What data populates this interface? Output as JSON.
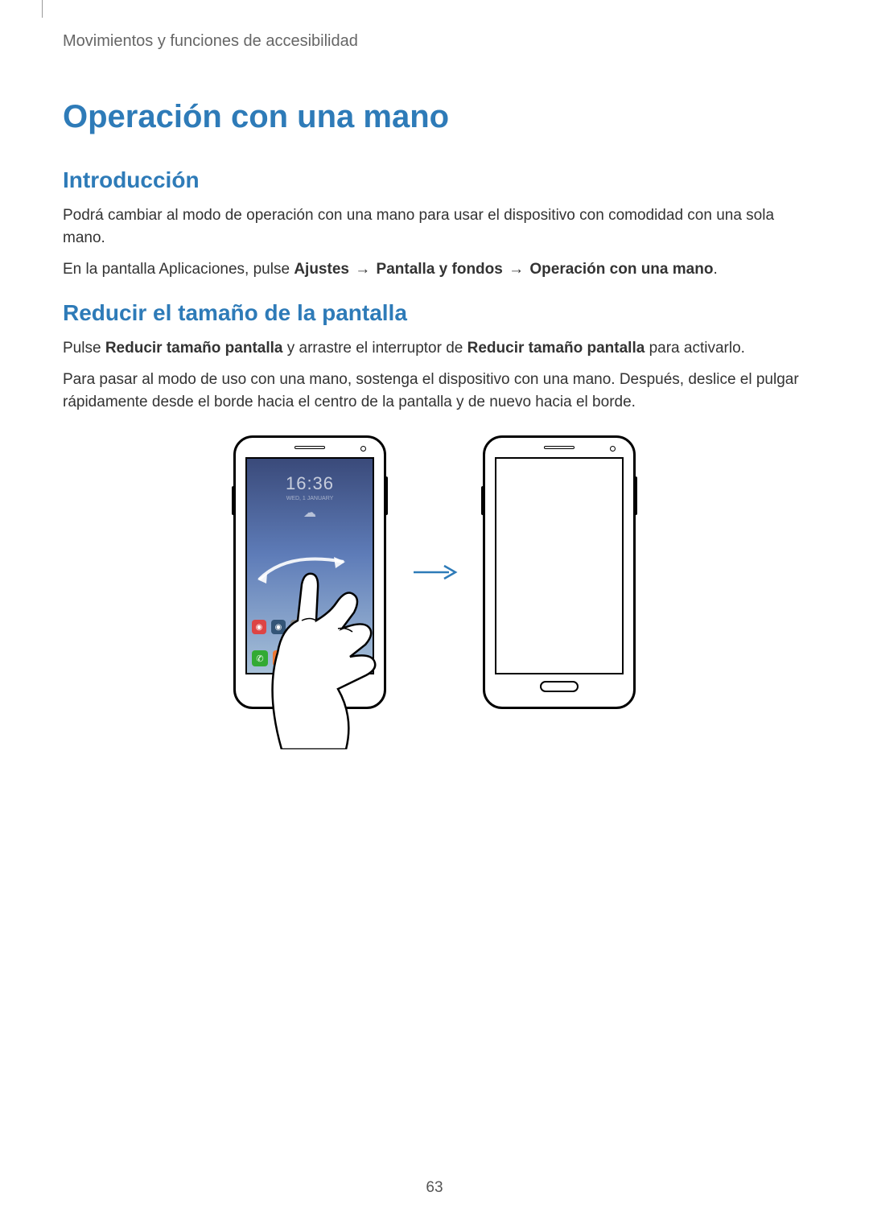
{
  "header": "Movimientos y funciones de accesibilidad",
  "title": "Operación con una mano",
  "section1": {
    "heading": "Introducción",
    "p1": "Podrá cambiar al modo de operación con una mano para usar el dispositivo con comodidad con una sola mano.",
    "p2_pre": "En la pantalla Aplicaciones, pulse ",
    "p2_b1": "Ajustes",
    "p2_arrow": " → ",
    "p2_b2": "Pantalla y fondos",
    "p2_b3": "Operación con una mano",
    "p2_post": "."
  },
  "section2": {
    "heading": "Reducir el tamaño de la pantalla",
    "p1_pre": "Pulse ",
    "p1_b1": "Reducir tamaño pantalla",
    "p1_mid": " y arrastre el interruptor de ",
    "p1_b2": "Reducir tamaño pantalla",
    "p1_post": " para activarlo.",
    "p2": "Para pasar al modo de uso con una mano, sostenga el dispositivo con una mano. Después, deslice el pulgar rápidamente desde el borde hacia el centro de la pantalla y de nuevo hacia el borde."
  },
  "illustration": {
    "clock": "16:36",
    "clock_sub": "WED, 1 JANUARY",
    "weather_icon": "☁"
  },
  "page_number": "63"
}
